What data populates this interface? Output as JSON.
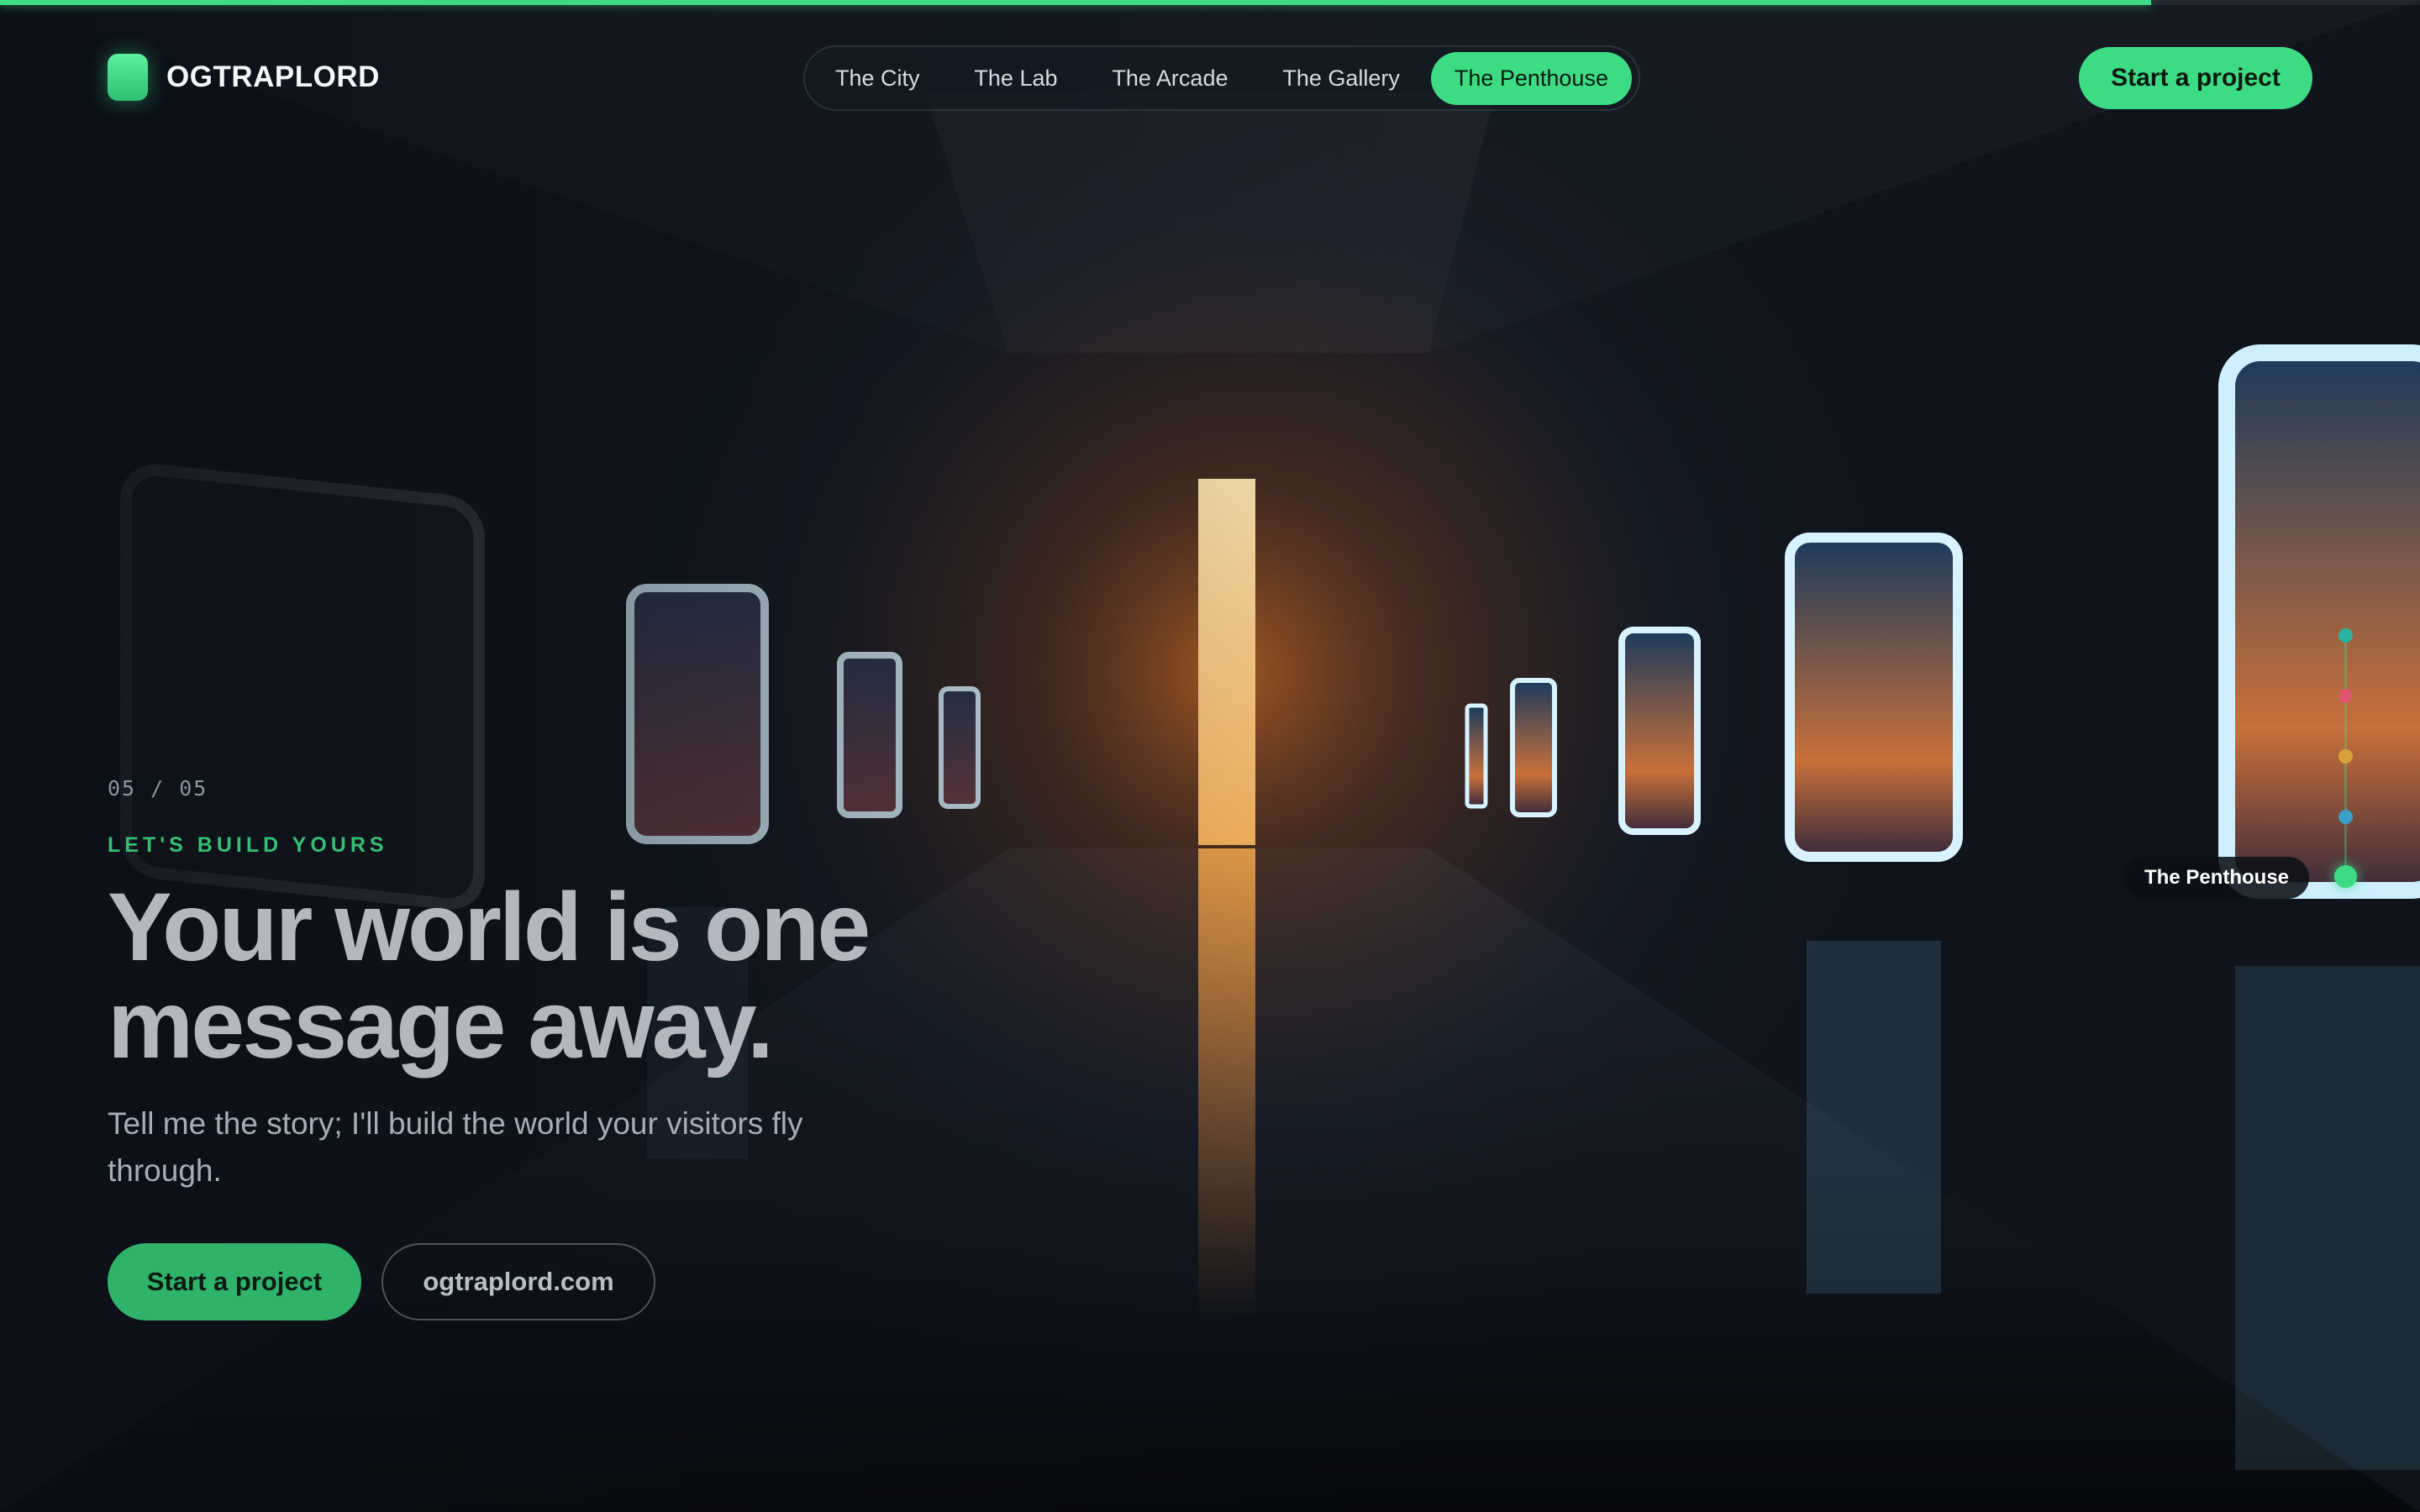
{
  "progress": {
    "fraction": 0.889
  },
  "brand": {
    "name": "OGTRAPLORD",
    "accent": "#3ddc84"
  },
  "nav": {
    "items": [
      {
        "label": "The City",
        "active": false
      },
      {
        "label": "The Lab",
        "active": false
      },
      {
        "label": "The Arcade",
        "active": false
      },
      {
        "label": "The Gallery",
        "active": false
      },
      {
        "label": "The Penthouse",
        "active": true
      }
    ]
  },
  "header": {
    "cta_label": "Start a project"
  },
  "hero": {
    "counter": "05 / 05",
    "eyebrow": "LET'S BUILD YOURS",
    "headline": "Your world is one message away.",
    "subtext": "Tell me the story; I'll build the world your visitors fly through.",
    "primary_button": "Start a project",
    "secondary_button": "ogtraplord.com"
  },
  "scene_rail": {
    "current_label": "The Penthouse",
    "dots": [
      {
        "color": "#2ab3a0"
      },
      {
        "color": "#e0566e"
      },
      {
        "color": "#d9a13a"
      },
      {
        "color": "#3aa0c8"
      },
      {
        "color": "#3ddc84"
      }
    ]
  },
  "background": {
    "description_icon": "neon-gallery-hallway-scene"
  }
}
